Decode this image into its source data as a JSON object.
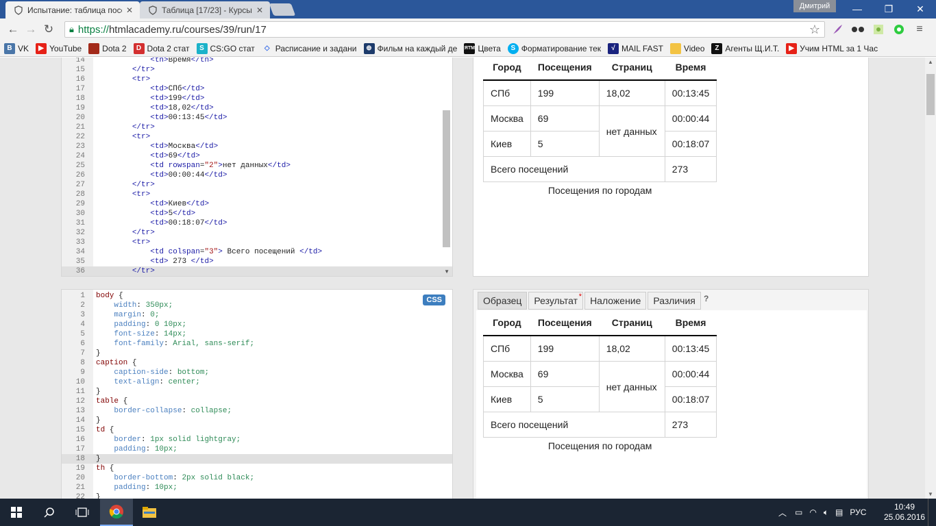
{
  "browser": {
    "tabs": [
      {
        "title": "Испытание: таблица посе",
        "active": true
      },
      {
        "title": "Таблица [17/23] - Курсы",
        "active": false
      }
    ],
    "user": "Дмитрий",
    "url_scheme": "https://",
    "url_rest": "htmlacademy.ru/courses/39/run/17",
    "bookmarks": [
      "VK",
      "YouTube",
      "Dota 2",
      "Dota 2 стат",
      "CS:GO стат",
      "Расписание и задани",
      "Фильм на каждый де",
      "Цвета",
      "Форматирование тек",
      "MAIL FAST",
      "Video",
      "Агенты Щ.И.Т.",
      "Учим HTML за 1 Час"
    ],
    "bookmark_badges": [
      "B",
      "▶",
      "D",
      "D",
      "S",
      "◇",
      "⊕",
      "ЯТМ",
      "S",
      "√",
      "",
      "Z",
      "▶"
    ]
  },
  "html_editor": {
    "lines": [
      {
        "n": "14",
        "code": "            <th>Время</th>"
      },
      {
        "n": "15",
        "code": "        </tr>"
      },
      {
        "n": "16",
        "code": "        <tr>"
      },
      {
        "n": "17",
        "code": "            <td>СПб</td>"
      },
      {
        "n": "18",
        "code": "            <td>199</td>"
      },
      {
        "n": "19",
        "code": "            <td>18,02</td>"
      },
      {
        "n": "20",
        "code": "            <td>00:13:45</td>"
      },
      {
        "n": "21",
        "code": "        </tr>"
      },
      {
        "n": "22",
        "code": "        <tr>"
      },
      {
        "n": "23",
        "code": "            <td>Москва</td>"
      },
      {
        "n": "24",
        "code": "            <td>69</td>"
      },
      {
        "n": "25",
        "code": "            <td rowspan=\"2\">нет данных</td>"
      },
      {
        "n": "26",
        "code": "            <td>00:00:44</td>"
      },
      {
        "n": "27",
        "code": "        </tr>"
      },
      {
        "n": "28",
        "code": "        <tr>"
      },
      {
        "n": "29",
        "code": "            <td>Киев</td>"
      },
      {
        "n": "30",
        "code": "            <td>5</td>"
      },
      {
        "n": "31",
        "code": "            <td>00:18:07</td>"
      },
      {
        "n": "32",
        "code": "        </tr>"
      },
      {
        "n": "33",
        "code": "        <tr>"
      },
      {
        "n": "34",
        "code": "            <td colspan=\"3\"> Всего посещений </td>"
      },
      {
        "n": "35",
        "code": "            <td> 273 </td>"
      },
      {
        "n": "36",
        "code": "        </tr>"
      }
    ],
    "current_line": "36"
  },
  "css_editor": {
    "badge": "CSS",
    "lines": [
      {
        "n": "1",
        "code": "body {"
      },
      {
        "n": "2",
        "code": "    width: 350px;"
      },
      {
        "n": "3",
        "code": "    margin: 0;"
      },
      {
        "n": "4",
        "code": "    padding: 0 10px;"
      },
      {
        "n": "5",
        "code": "    font-size: 14px;"
      },
      {
        "n": "6",
        "code": "    font-family: Arial, sans-serif;"
      },
      {
        "n": "7",
        "code": "}"
      },
      {
        "n": "8",
        "code": "caption {"
      },
      {
        "n": "9",
        "code": "    caption-side: bottom;"
      },
      {
        "n": "10",
        "code": "    text-align: center;"
      },
      {
        "n": "11",
        "code": "}"
      },
      {
        "n": "12",
        "code": "table {"
      },
      {
        "n": "13",
        "code": "    border-collapse: collapse;"
      },
      {
        "n": "14",
        "code": "}"
      },
      {
        "n": "15",
        "code": "td {"
      },
      {
        "n": "16",
        "code": "    border: 1px solid lightgray;"
      },
      {
        "n": "17",
        "code": "    padding: 10px;"
      },
      {
        "n": "18",
        "code": "}"
      },
      {
        "n": "19",
        "code": "th {"
      },
      {
        "n": "20",
        "code": "    border-bottom: 2px solid black;"
      },
      {
        "n": "21",
        "code": "    padding: 10px;"
      },
      {
        "n": "22",
        "code": "}"
      }
    ],
    "current_line": "18"
  },
  "result_table": {
    "headers": [
      "Город",
      "Посещения",
      "Страниц",
      "Время"
    ],
    "rows": [
      [
        "СПб",
        "199",
        "18,02",
        "00:13:45"
      ],
      [
        "Москва",
        "69",
        "нет данных",
        "00:00:44"
      ],
      [
        "Киев",
        "5",
        "00:18:07"
      ]
    ],
    "total_label": "Всего посещений",
    "total_value": "273",
    "caption": "Посещения по городам"
  },
  "sample_tabs": [
    "Образец",
    "Результат",
    "Наложение",
    "Различия"
  ],
  "sample_tabs_extra": {
    "modified_mark": "*",
    "help": "?"
  },
  "taskbar": {
    "lang": "РУС",
    "time": "10:49",
    "date": "25.06.2016"
  }
}
